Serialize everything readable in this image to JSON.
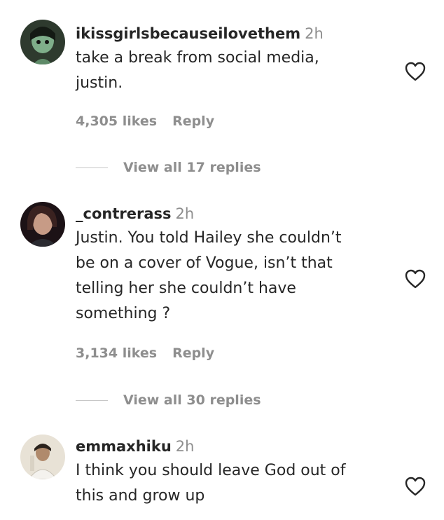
{
  "comments": [
    {
      "username": "ikissgirlsbecauseilovethem",
      "time": "2h",
      "lines": [
        "take a break from social media,",
        "justin."
      ],
      "likes": "4,305 likes",
      "reply_label": "Reply",
      "view_replies": "View all 17 replies"
    },
    {
      "username": "_contrerass",
      "time": "2h",
      "lines": [
        "Justin. You told Hailey she couldn’t",
        "be on a cover of Vogue, isn’t that",
        "telling her she couldn’t have",
        "something ?"
      ],
      "likes": "3,134 likes",
      "reply_label": "Reply",
      "view_replies": "View all 30 replies"
    },
    {
      "username": "emmaxhiku",
      "time": "2h",
      "lines": [
        "I think you should leave God out of",
        "this and grow up"
      ]
    }
  ],
  "icons": {
    "like": "heart-outline-icon"
  },
  "colors": {
    "primary_text": "#262626",
    "secondary_text": "#8e8e8e",
    "divider": "#c7c7c7"
  }
}
